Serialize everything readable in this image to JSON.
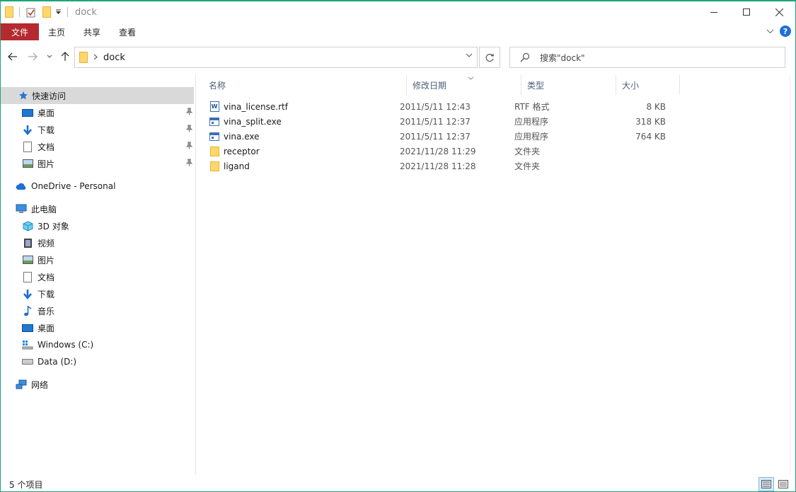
{
  "window": {
    "title": "dock",
    "accent_color": "#1fa37a",
    "icons": [
      "folder-icon",
      "properties-icon",
      "new-folder-icon",
      "qat-dropdown-icon"
    ]
  },
  "ribbon": {
    "tabs": [
      {
        "label": "文件",
        "color": "#b52a2f"
      },
      {
        "label": "主页"
      },
      {
        "label": "共享"
      },
      {
        "label": "查看"
      }
    ],
    "help_glyph": "?"
  },
  "nav": {
    "address_path": [
      "dock"
    ],
    "search_placeholder": "搜索\"dock\""
  },
  "sidebar": {
    "quick_access": {
      "label": "快速访问"
    },
    "pinned": [
      {
        "label": "桌面",
        "icon": "desktop-icon"
      },
      {
        "label": "下载",
        "icon": "download-icon"
      },
      {
        "label": "文档",
        "icon": "document-icon"
      },
      {
        "label": "图片",
        "icon": "pictures-icon"
      }
    ],
    "onedrive": {
      "label": "OneDrive - Personal"
    },
    "this_pc": {
      "label": "此电脑"
    },
    "pc_items": [
      {
        "label": "3D 对象",
        "icon": "3d-objects-icon"
      },
      {
        "label": "视频",
        "icon": "video-icon"
      },
      {
        "label": "图片",
        "icon": "pictures-icon"
      },
      {
        "label": "文档",
        "icon": "document-icon"
      },
      {
        "label": "下载",
        "icon": "download-icon"
      },
      {
        "label": "音乐",
        "icon": "music-icon"
      },
      {
        "label": "桌面",
        "icon": "desktop-icon"
      },
      {
        "label": "Windows (C:)",
        "icon": "windows-drive-icon"
      },
      {
        "label": "Data (D:)",
        "icon": "drive-icon"
      }
    ],
    "network": {
      "label": "网络"
    }
  },
  "columns": {
    "name": "名称",
    "date": "修改日期",
    "type": "类型",
    "size": "大小"
  },
  "files": [
    {
      "name": "vina_license.rtf",
      "date": "2011/5/11 12:43",
      "type": "RTF 格式",
      "size": "8 KB",
      "icon": "rtf-icon"
    },
    {
      "name": "vina_split.exe",
      "date": "2011/5/11 12:37",
      "type": "应用程序",
      "size": "318 KB",
      "icon": "exe-icon"
    },
    {
      "name": "vina.exe",
      "date": "2011/5/11 12:37",
      "type": "应用程序",
      "size": "764 KB",
      "icon": "exe-icon"
    },
    {
      "name": "receptor",
      "date": "2021/11/28 11:29",
      "type": "文件夹",
      "size": "",
      "icon": "folder-icon"
    },
    {
      "name": "ligand",
      "date": "2021/11/28 11:28",
      "type": "文件夹",
      "size": "",
      "icon": "folder-icon"
    }
  ],
  "status": {
    "item_count": "5 个项目"
  }
}
